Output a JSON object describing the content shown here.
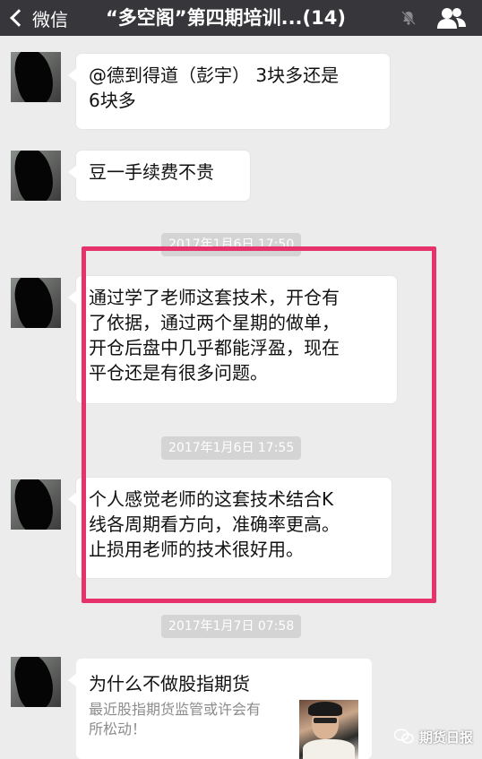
{
  "navbar": {
    "back_label": "微信",
    "title": "“多空阁”第四期培训...(14)",
    "bg_color": "#36363b"
  },
  "messages": [
    {
      "lines": [
        "@德到得道（彭宇） 3块多还是",
        "6块多"
      ]
    },
    {
      "lines": [
        "豆一手续费不贵"
      ]
    },
    {
      "lines": [
        "通过学了老师这套技术，开仓有",
        "了依据，通过两个星期的做单，",
        "开仓后盘中几乎都能浮盈，现在",
        "平仓还是有很多问题。"
      ]
    },
    {
      "lines": [
        "个人感觉老师的这套技术结合K",
        "线各周期看方向，准确率更高。",
        "止损用老师的技术很好用。"
      ]
    }
  ],
  "timestamps": [
    "2017年1月6日 17:50",
    "2017年1月6日 17:55",
    "2017年1月7日 07:58"
  ],
  "card": {
    "title": "为什么不做股指期货",
    "desc_lines": [
      "最近股指期货监管或许会有",
      "所松动！"
    ]
  },
  "watermark": {
    "text": "期货日报"
  },
  "colors": {
    "highlight": "#e6336c",
    "background": "#ececec"
  },
  "icons": [
    "chevron-left-icon",
    "mute-icon",
    "group-members-icon",
    "wechat-logo-icon"
  ]
}
